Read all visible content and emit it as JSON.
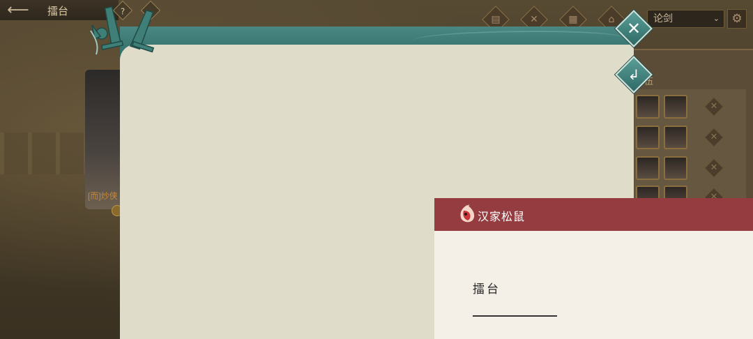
{
  "top_bar": {
    "title": "擂台",
    "help_label": "?",
    "back_icon": "arrow-left-icon"
  },
  "mode_select": {
    "selected": "论剑"
  },
  "background": {
    "hero_name": "[而]炒侠",
    "panel_label": "伍"
  },
  "dialog": {
    "close_icon": "close-icon",
    "return_icon": "return-arrow-icon",
    "header_color": "#3a7a76",
    "body_color": "#dfddca"
  },
  "web_panel": {
    "brand": "汉家松鼠",
    "title": "擂台",
    "header_color": "#953c41"
  }
}
